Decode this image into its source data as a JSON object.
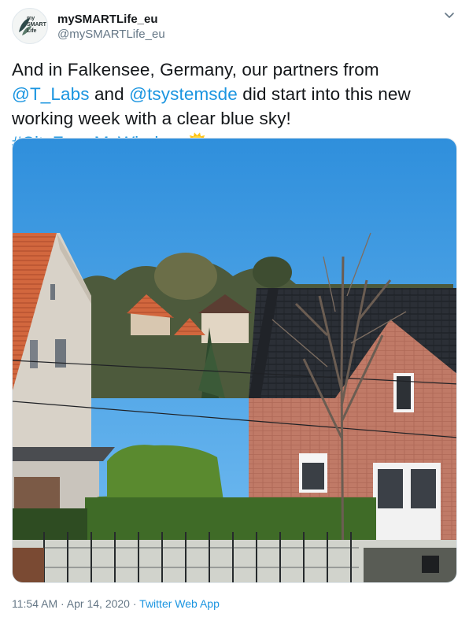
{
  "author": {
    "display_name": "mySMARTLife_eu",
    "handle": "@mySMARTLife_eu",
    "avatar_logo": {
      "line1": "my",
      "line2": "SMART",
      "line3": "Life"
    }
  },
  "tweet": {
    "text_segments": [
      {
        "text": "And in Falkensee, Germany, our partners from ",
        "type": "text"
      },
      {
        "text": "@T_Labs",
        "type": "mention"
      },
      {
        "text": " and ",
        "type": "text"
      },
      {
        "text": "@tsystemsde",
        "type": "mention"
      },
      {
        "text": " did start into this new working week with a clear blue sky! ",
        "type": "text"
      },
      {
        "text": "#CityFromMyWindow",
        "type": "hashtag"
      },
      {
        "text": " 🌞",
        "type": "text"
      }
    ]
  },
  "meta": {
    "time": "11:54 AM",
    "separator": " · ",
    "date": "Apr 14, 2020",
    "source": "Twitter Web App"
  },
  "icons": {
    "menu": "chevron-down-icon"
  },
  "colors": {
    "link": "#1b95e0",
    "secondary_text": "#657786",
    "primary_text": "#14171a"
  }
}
